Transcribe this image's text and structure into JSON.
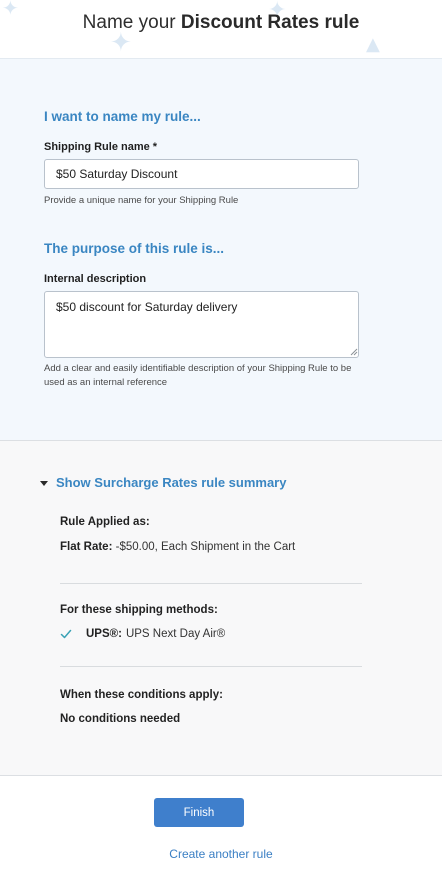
{
  "header": {
    "title_prefix": "Name your",
    "title_bold": "Discount Rates rule"
  },
  "name_section": {
    "heading": "I want to name my rule...",
    "label": "Shipping Rule name *",
    "value": "$50 Saturday Discount",
    "helper": "Provide a unique name for your Shipping Rule"
  },
  "purpose_section": {
    "heading": "The purpose of this rule is...",
    "label": "Internal description",
    "value": "$50 discount for Saturday delivery",
    "helper": "Add a clear and easily identifiable description of your Shipping Rule to be used as an internal reference"
  },
  "summary": {
    "toggle_label": "Show Surcharge Rates rule summary",
    "applied_heading": "Rule Applied as:",
    "rate_label": "Flat Rate:",
    "rate_value": "-$50.00, Each Shipment in the Cart",
    "methods_heading": "For these shipping methods:",
    "method_carrier": "UPS®:",
    "method_name": "UPS Next Day Air®",
    "conditions_heading": "When these conditions apply:",
    "conditions_value": "No conditions needed"
  },
  "actions": {
    "finish_label": "Finish",
    "create_another_label": "Create another rule"
  },
  "colors": {
    "accent": "#3a86c2",
    "button": "#3f7fcc",
    "panel": "#f3f8fd",
    "check": "#3aa2b5"
  }
}
